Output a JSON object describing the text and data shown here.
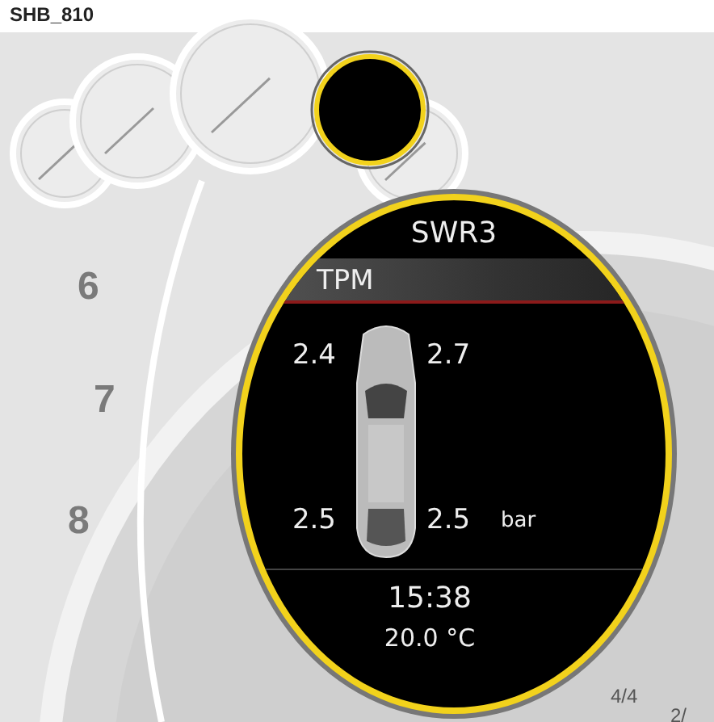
{
  "caption": "SHB_810",
  "tach_labels": [
    "6",
    "7",
    "8"
  ],
  "gear_marks": [
    "4/4",
    "2/"
  ],
  "display": {
    "title": "SWR3",
    "menu_label": "TPM",
    "tires": [
      {
        "kind": "front-left",
        "pressure": "2.4"
      },
      {
        "kind": "front-right",
        "pressure": "2.7"
      },
      {
        "kind": "rear-left",
        "pressure": "2.5"
      },
      {
        "kind": "rear-right",
        "pressure": "2.5"
      }
    ],
    "unit": "bar",
    "time": "15:38",
    "temperature": "20.0 °C"
  }
}
